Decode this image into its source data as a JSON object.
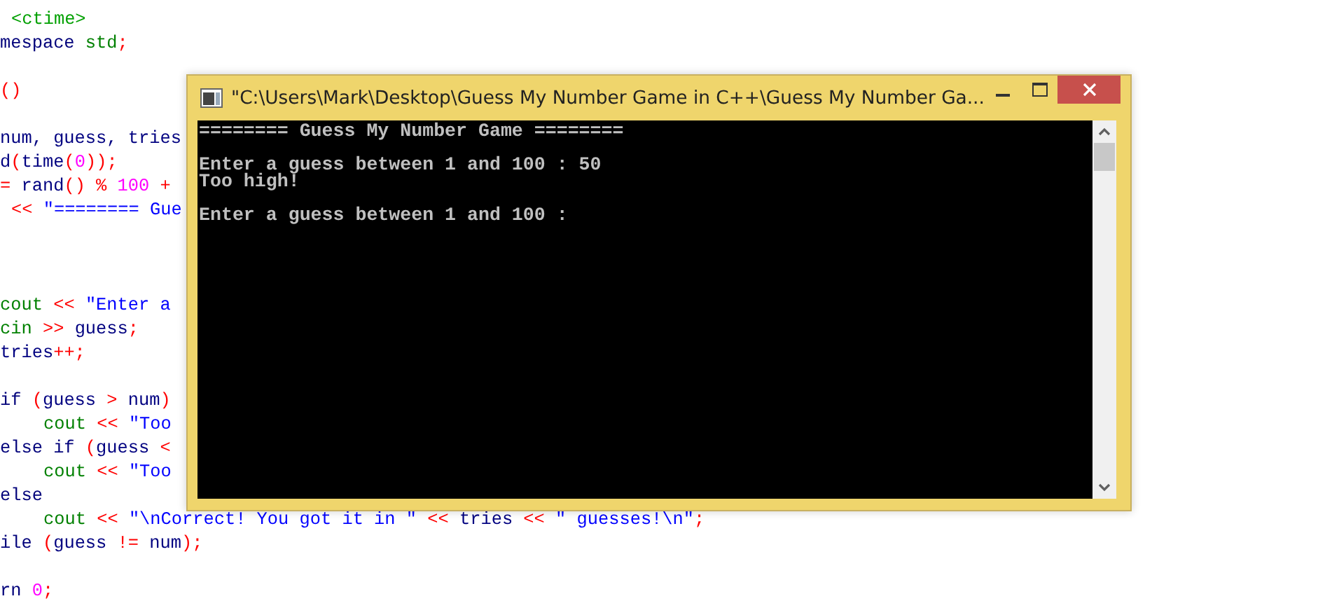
{
  "editor": {
    "lines": [
      {
        "kind": "code-offset",
        "tokens": [
          {
            "kind": "header",
            "text": "<ctime>"
          }
        ]
      },
      {
        "kind": "code",
        "tokens": [
          {
            "kind": "keyword",
            "text": "mespace "
          },
          {
            "kind": "ident",
            "text": "std"
          },
          {
            "kind": "op",
            "text": ";"
          }
        ]
      },
      {
        "kind": "blank"
      },
      {
        "kind": "code",
        "tokens": [
          {
            "kind": "op",
            "text": "()"
          }
        ]
      },
      {
        "kind": "blank"
      },
      {
        "kind": "code",
        "tokens": [
          {
            "kind": "plain",
            "text": "num, guess, tries"
          }
        ]
      },
      {
        "kind": "code",
        "tokens": [
          {
            "kind": "plain",
            "text": "d"
          },
          {
            "kind": "op",
            "text": "("
          },
          {
            "kind": "plain",
            "text": "time"
          },
          {
            "kind": "op",
            "text": "("
          },
          {
            "kind": "number",
            "text": "0"
          },
          {
            "kind": "op",
            "text": "));"
          }
        ]
      },
      {
        "kind": "code",
        "tokens": [
          {
            "kind": "op",
            "text": "= "
          },
          {
            "kind": "plain",
            "text": "rand"
          },
          {
            "kind": "op",
            "text": "() % "
          },
          {
            "kind": "number",
            "text": "100"
          },
          {
            "kind": "op",
            "text": " +"
          }
        ]
      },
      {
        "kind": "code-offset",
        "tokens": [
          {
            "kind": "op",
            "text": "<< "
          },
          {
            "kind": "string",
            "text": "\"======== Gue"
          }
        ]
      },
      {
        "kind": "blank"
      },
      {
        "kind": "blank"
      },
      {
        "kind": "blank"
      },
      {
        "kind": "code",
        "tokens": [
          {
            "kind": "ident",
            "text": "cout"
          },
          {
            "kind": "op",
            "text": " << "
          },
          {
            "kind": "string",
            "text": "\"Enter a"
          }
        ]
      },
      {
        "kind": "code",
        "tokens": [
          {
            "kind": "ident",
            "text": "cin"
          },
          {
            "kind": "op",
            "text": " >> "
          },
          {
            "kind": "plain",
            "text": "guess"
          },
          {
            "kind": "op",
            "text": ";"
          }
        ]
      },
      {
        "kind": "code",
        "tokens": [
          {
            "kind": "plain",
            "text": "tries"
          },
          {
            "kind": "op",
            "text": "++;"
          }
        ]
      },
      {
        "kind": "blank"
      },
      {
        "kind": "code",
        "tokens": [
          {
            "kind": "keyword",
            "text": "if "
          },
          {
            "kind": "op",
            "text": "("
          },
          {
            "kind": "plain",
            "text": "guess "
          },
          {
            "kind": "op",
            "text": "> "
          },
          {
            "kind": "plain",
            "text": "num"
          },
          {
            "kind": "op",
            "text": ")"
          }
        ]
      },
      {
        "kind": "code-indented",
        "tokens": [
          {
            "kind": "ident",
            "text": "cout"
          },
          {
            "kind": "op",
            "text": " << "
          },
          {
            "kind": "string",
            "text": "\"Too"
          }
        ]
      },
      {
        "kind": "code",
        "tokens": [
          {
            "kind": "keyword",
            "text": "else if "
          },
          {
            "kind": "op",
            "text": "("
          },
          {
            "kind": "plain",
            "text": "guess "
          },
          {
            "kind": "op",
            "text": "<"
          }
        ]
      },
      {
        "kind": "code-indented",
        "tokens": [
          {
            "kind": "ident",
            "text": "cout"
          },
          {
            "kind": "op",
            "text": " << "
          },
          {
            "kind": "string",
            "text": "\"Too"
          }
        ]
      },
      {
        "kind": "code",
        "tokens": [
          {
            "kind": "keyword",
            "text": "else"
          }
        ]
      },
      {
        "kind": "code-indented",
        "tokens": [
          {
            "kind": "ident",
            "text": "cout"
          },
          {
            "kind": "op",
            "text": " << "
          },
          {
            "kind": "string",
            "text": "\"\\nCorrect! You got it in \""
          },
          {
            "kind": "op",
            "text": " << "
          },
          {
            "kind": "plain",
            "text": "tries"
          },
          {
            "kind": "op",
            "text": " << "
          },
          {
            "kind": "string",
            "text": "\" guesses!\\n\""
          },
          {
            "kind": "op",
            "text": ";"
          }
        ]
      },
      {
        "kind": "code",
        "tokens": [
          {
            "kind": "keyword",
            "text": "ile "
          },
          {
            "kind": "op",
            "text": "("
          },
          {
            "kind": "plain",
            "text": "guess "
          },
          {
            "kind": "op",
            "text": "!= "
          },
          {
            "kind": "plain",
            "text": "num"
          },
          {
            "kind": "op",
            "text": ");"
          }
        ]
      },
      {
        "kind": "blank"
      },
      {
        "kind": "code",
        "tokens": [
          {
            "kind": "keyword",
            "text": "rn "
          },
          {
            "kind": "number",
            "text": "0"
          },
          {
            "kind": "op",
            "text": ";"
          }
        ]
      }
    ]
  },
  "console_window": {
    "title": "\"C:\\Users\\Mark\\Desktop\\Guess My Number Game in C++\\Guess My Number Ga...",
    "output": [
      {
        "kind": "text",
        "text": "======== Guess My Number Game ========"
      },
      {
        "kind": "blank"
      },
      {
        "kind": "text",
        "text": "Enter a guess between 1 and 100 : 50"
      },
      {
        "kind": "text",
        "text": "Too high!"
      },
      {
        "kind": "blank"
      },
      {
        "kind": "text",
        "text": "Enter a guess between 1 and 100 :"
      }
    ]
  }
}
